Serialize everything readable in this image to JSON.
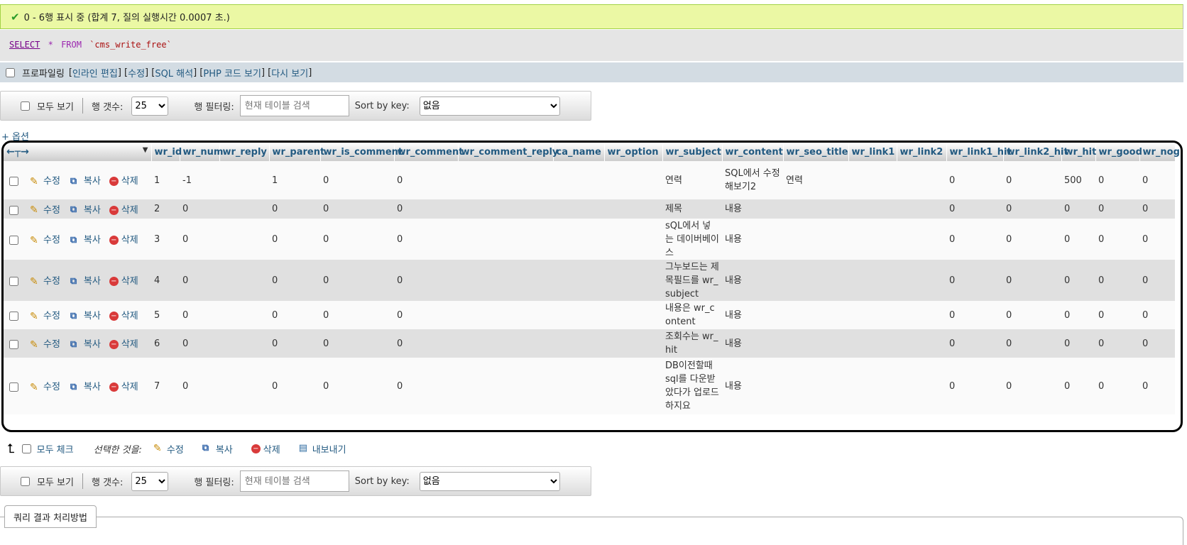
{
  "success": {
    "message": "0 - 6행 표시 중 (합계 7, 질의 실행시간 0.0007 초.)"
  },
  "sql": {
    "select": "SELECT",
    "star": "*",
    "from": "FROM",
    "table": "`cms_write_free`"
  },
  "profiling": {
    "label": "프로파일링",
    "links": [
      "인라인 편집",
      "수정",
      "SQL 해석",
      "PHP 코드 보기",
      "다시 보기"
    ]
  },
  "nav": {
    "show_all": "모두 보기",
    "row_count_label": "행 갯수:",
    "row_count_value": "25",
    "filter_label": "행 필터링:",
    "filter_placeholder": "현재 테이블 검색",
    "sort_label": "Sort by key:",
    "sort_value": "없음"
  },
  "options_link": "+ 옵션",
  "table": {
    "columns": [
      "wr_id",
      "wr_num",
      "wr_reply",
      "wr_parent",
      "wr_is_comment",
      "wr_comment",
      "wr_comment_reply",
      "ca_name",
      "wr_option",
      "wr_subject",
      "wr_content",
      "wr_seo_title",
      "wr_link1",
      "wr_link2",
      "wr_link1_hit",
      "wr_link2_hit",
      "wr_hit",
      "wr_good",
      "wr_nog"
    ],
    "action_labels": {
      "edit": "수정",
      "copy": "복사",
      "delete": "삭제"
    },
    "rows": [
      {
        "wr_id": "1",
        "wr_num": "-1",
        "wr_reply": "",
        "wr_parent": "1",
        "wr_is_comment": "0",
        "wr_comment": "0",
        "wr_comment_reply": "",
        "ca_name": "",
        "wr_option": "",
        "wr_subject": "연력",
        "wr_content": "SQL에서 수정해보기2",
        "wr_seo_title": "연력",
        "wr_link1": "",
        "wr_link2": "",
        "wr_link1_hit": "0",
        "wr_link2_hit": "0",
        "wr_hit": "500",
        "wr_good": "0",
        "wr_nog": "0"
      },
      {
        "wr_id": "2",
        "wr_num": "0",
        "wr_reply": "",
        "wr_parent": "0",
        "wr_is_comment": "0",
        "wr_comment": "0",
        "wr_comment_reply": "",
        "ca_name": "",
        "wr_option": "",
        "wr_subject": "제목",
        "wr_content": "내용",
        "wr_seo_title": "",
        "wr_link1": "",
        "wr_link2": "",
        "wr_link1_hit": "0",
        "wr_link2_hit": "0",
        "wr_hit": "0",
        "wr_good": "0",
        "wr_nog": "0"
      },
      {
        "wr_id": "3",
        "wr_num": "0",
        "wr_reply": "",
        "wr_parent": "0",
        "wr_is_comment": "0",
        "wr_comment": "0",
        "wr_comment_reply": "",
        "ca_name": "",
        "wr_option": "",
        "wr_subject": "sQL에서 넣는 데이버베이스",
        "wr_content": "내용",
        "wr_seo_title": "",
        "wr_link1": "",
        "wr_link2": "",
        "wr_link1_hit": "0",
        "wr_link2_hit": "0",
        "wr_hit": "0",
        "wr_good": "0",
        "wr_nog": "0"
      },
      {
        "wr_id": "4",
        "wr_num": "0",
        "wr_reply": "",
        "wr_parent": "0",
        "wr_is_comment": "0",
        "wr_comment": "0",
        "wr_comment_reply": "",
        "ca_name": "",
        "wr_option": "",
        "wr_subject": "그누보드는 제목필드를 wr_subject",
        "wr_content": "내용",
        "wr_seo_title": "",
        "wr_link1": "",
        "wr_link2": "",
        "wr_link1_hit": "0",
        "wr_link2_hit": "0",
        "wr_hit": "0",
        "wr_good": "0",
        "wr_nog": "0"
      },
      {
        "wr_id": "5",
        "wr_num": "0",
        "wr_reply": "",
        "wr_parent": "0",
        "wr_is_comment": "0",
        "wr_comment": "0",
        "wr_comment_reply": "",
        "ca_name": "",
        "wr_option": "",
        "wr_subject": "내용은 wr_content",
        "wr_content": "내용",
        "wr_seo_title": "",
        "wr_link1": "",
        "wr_link2": "",
        "wr_link1_hit": "0",
        "wr_link2_hit": "0",
        "wr_hit": "0",
        "wr_good": "0",
        "wr_nog": "0"
      },
      {
        "wr_id": "6",
        "wr_num": "0",
        "wr_reply": "",
        "wr_parent": "0",
        "wr_is_comment": "0",
        "wr_comment": "0",
        "wr_comment_reply": "",
        "ca_name": "",
        "wr_option": "",
        "wr_subject": "조회수는 wr_hit",
        "wr_content": "내용",
        "wr_seo_title": "",
        "wr_link1": "",
        "wr_link2": "",
        "wr_link1_hit": "0",
        "wr_link2_hit": "0",
        "wr_hit": "0",
        "wr_good": "0",
        "wr_nog": "0"
      },
      {
        "wr_id": "7",
        "wr_num": "0",
        "wr_reply": "",
        "wr_parent": "0",
        "wr_is_comment": "0",
        "wr_comment": "0",
        "wr_comment_reply": "",
        "ca_name": "",
        "wr_option": "",
        "wr_subject": "DB이전할때 sql를 다운받았다가 업로드하지요",
        "wr_content": "내용",
        "wr_seo_title": "",
        "wr_link1": "",
        "wr_link2": "",
        "wr_link1_hit": "0",
        "wr_link2_hit": "0",
        "wr_hit": "0",
        "wr_good": "0",
        "wr_nog": "0"
      }
    ]
  },
  "bulk": {
    "check_all": "모두 체크",
    "with_selected": "선택한 것을:",
    "edit": "수정",
    "copy": "복사",
    "delete": "삭제",
    "export": "내보내기"
  },
  "query_ops": {
    "label": "쿼리 결과 처리방법"
  },
  "colors": {
    "success_bg": "#ebf8a4",
    "link": "#235a81",
    "row_even": "#e0e0e0"
  }
}
